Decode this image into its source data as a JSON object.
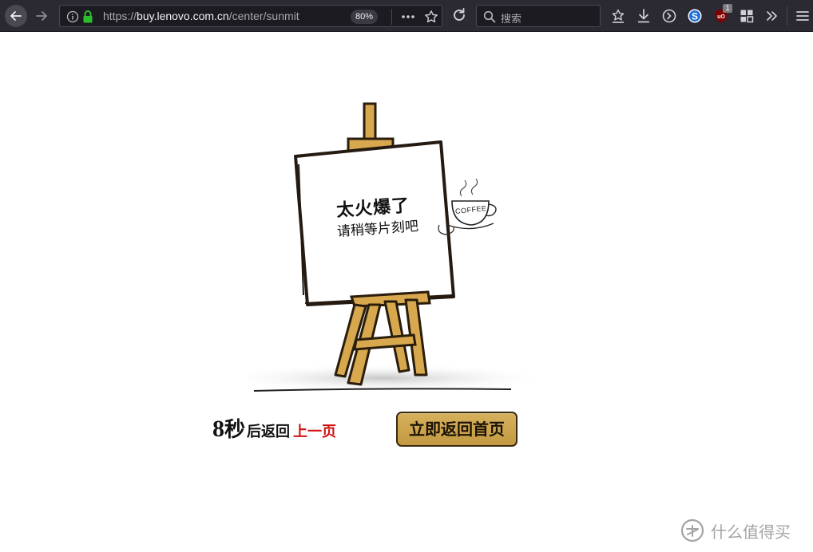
{
  "browser": {
    "url_scheme": "https://",
    "url_host": "buy.lenovo.com.cn",
    "url_path": "/center/sunmit",
    "zoom": "80%",
    "search_placeholder": "搜索",
    "addon_badge": "1",
    "icons": [
      "back-icon",
      "forward-icon",
      "info-icon",
      "lock-icon",
      "more-icon",
      "bookmark-star-icon",
      "reload-icon",
      "search-icon",
      "library-icon",
      "download-icon",
      "history-icon",
      "sogou-icon",
      "ublock-icon",
      "extensions-icon",
      "overflow-icon",
      "menu-icon"
    ]
  },
  "page": {
    "sign_title": "太火爆了",
    "sign_subtitle": "请稍等片刻吧",
    "coffee_label": "COFFEE",
    "countdown_number": "8",
    "countdown_unit": "秒",
    "countdown_after": "后返回",
    "prev_link": "上一页",
    "home_button": "立即返回首页",
    "watermark_text": "什么值得买",
    "colors": {
      "link_red": "#d21010",
      "button_gold": "#cfa852",
      "easel_wood": "#d8a84e"
    }
  }
}
